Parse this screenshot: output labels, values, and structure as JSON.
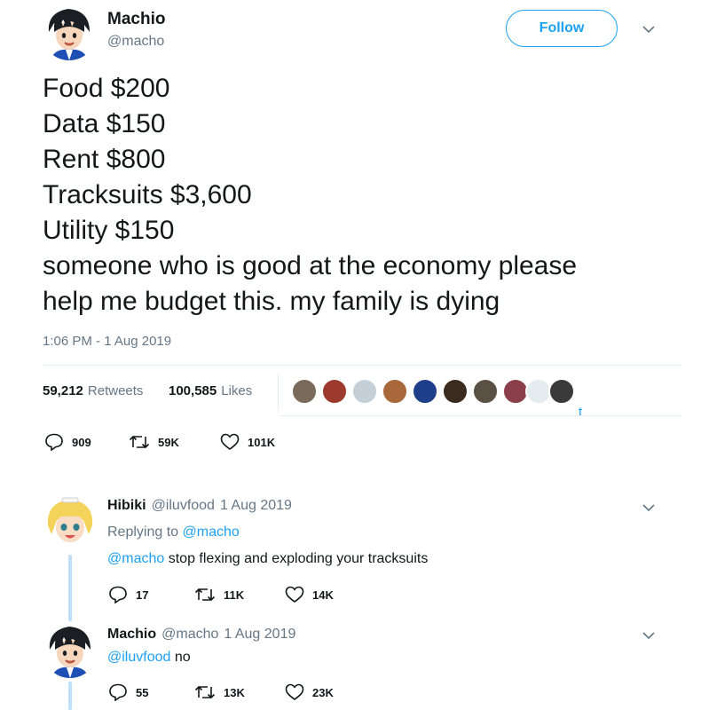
{
  "tweet": {
    "author_name": "Machio",
    "author_handle": "@macho",
    "follow_label": "Follow",
    "lines": [
      "Food $200",
      "Data $150",
      "Rent $800",
      "Tracksuits $3,600",
      "Utility $150",
      "someone who is good at the economy please",
      "help me budget this. my family is dying"
    ],
    "timestamp": "1:06 PM - 1 Aug 2019",
    "retweets_count": "59,212",
    "retweets_label": "Retweets",
    "likes_count": "100,585",
    "likes_label": "Likes",
    "stray_char": "t",
    "actions": {
      "replies": "909",
      "retweets": "59K",
      "likes": "101K"
    }
  },
  "replies": [
    {
      "name": "Hibiki",
      "handle": "@iluvfood",
      "date": "1 Aug 2019",
      "replying_prefix": "Replying to",
      "replying_to": "@macho",
      "mention": "@macho",
      "text": "stop flexing and exploding your tracksuits",
      "actions": {
        "replies": "17",
        "retweets": "11K",
        "likes": "14K"
      }
    },
    {
      "name": "Machio",
      "handle": "@macho",
      "date": "1 Aug 2019",
      "mention": "@iluvfood",
      "text": "no",
      "actions": {
        "replies": "55",
        "retweets": "13K",
        "likes": "23K"
      }
    }
  ],
  "colors": {
    "accent": "#1da1f2",
    "muted": "#657786",
    "divider": "#e6ecf0",
    "thread": "#bce0fa"
  },
  "icons": [
    "reply-icon",
    "retweet-icon",
    "like-icon",
    "chevron-down-icon"
  ]
}
